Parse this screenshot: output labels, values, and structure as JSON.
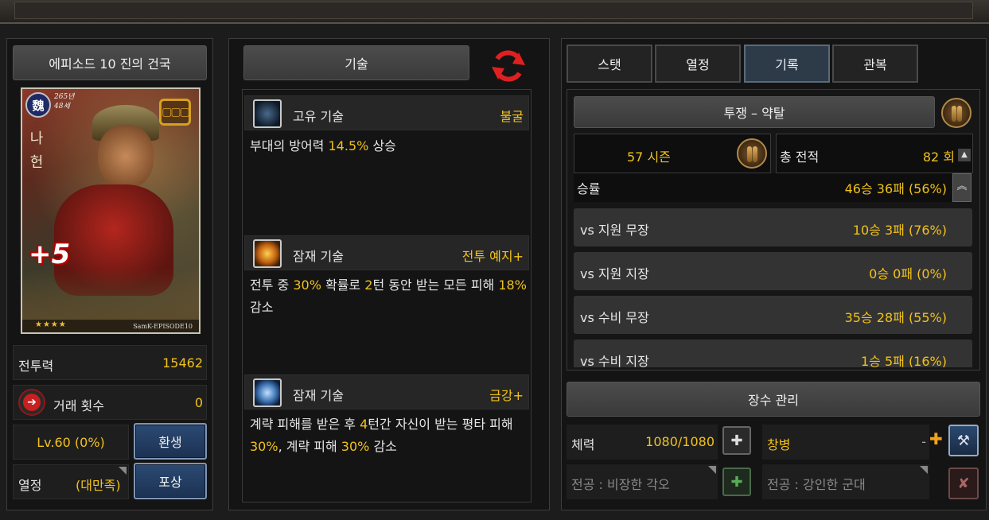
{
  "left": {
    "episode_title": "에피소드 10 진의 건국",
    "card": {
      "kingdom": "魏",
      "birth_year": "265년",
      "age": "48세",
      "name_vertical": [
        "나",
        "헌"
      ],
      "plus": "+5",
      "stars": "★★★★",
      "signature": "SamK-EPISODE10"
    },
    "combat_power_label": "전투력",
    "combat_power_value": "15462",
    "trade_label": "거래 횟수",
    "trade_value": "0",
    "level": "Lv.60 (0%)",
    "rebirth_button": "환생",
    "passion_label": "열정",
    "passion_value": "(대만족)",
    "reward_button": "포상"
  },
  "middle": {
    "tab_label": "기술",
    "skills": [
      {
        "type": "고유 기술",
        "name": "불굴",
        "desc_parts": [
          [
            "부대의 방어력 ",
            false
          ],
          [
            "14.5%",
            true
          ],
          [
            " 상승",
            false
          ]
        ]
      },
      {
        "type": "잠재 기술",
        "name": "전투 예지+",
        "desc_parts": [
          [
            "전투 중 ",
            false
          ],
          [
            "30%",
            true
          ],
          [
            " 확률로 ",
            false
          ],
          [
            "2",
            true
          ],
          [
            "턴 동안 받는 모든 피해 ",
            false
          ],
          [
            "18%",
            true
          ],
          [
            " 감소",
            false
          ]
        ]
      },
      {
        "type": "잠재 기술",
        "name": "금강+",
        "desc_parts": [
          [
            "계략 피해를 받은 후 ",
            false
          ],
          [
            "4",
            true
          ],
          [
            "턴간 자신이 받는 평타 피해 ",
            false
          ],
          [
            "30%",
            true
          ],
          [
            ", 계략 피해 ",
            false
          ],
          [
            "30%",
            true
          ],
          [
            " 감소",
            false
          ]
        ]
      }
    ]
  },
  "right": {
    "tabs": [
      "스탯",
      "열정",
      "기록",
      "관복"
    ],
    "active_tab": "기록",
    "arena_title": "투쟁 – 약탈",
    "season": "57 시즌",
    "total_battles_label": "총 전적",
    "total_battles_value": "82 회",
    "win_rate_label": "승률",
    "win_rate_value": "46승 36패 (56%)",
    "rows": [
      {
        "label": "vs 지원 무장",
        "value": "10승 3패 (76%)"
      },
      {
        "label": "vs 지원 지장",
        "value": "0승 0패 (0%)"
      },
      {
        "label": "vs 수비 무장",
        "value": "35승 28패 (55%)"
      },
      {
        "label": "vs 수비 지장",
        "value": "1승 5패 (16%)"
      }
    ],
    "manage_button": "장수 관리",
    "hp_label": "체력",
    "hp_value": "1080/1080",
    "weapon_name": "창병",
    "weapon_dash": "-",
    "merit1": "전공 : 비장한 각오",
    "merit2": "전공 : 강인한 군대"
  },
  "colors": {
    "accent_yellow": "#f2c21b",
    "blue_button": "#1b3152"
  }
}
